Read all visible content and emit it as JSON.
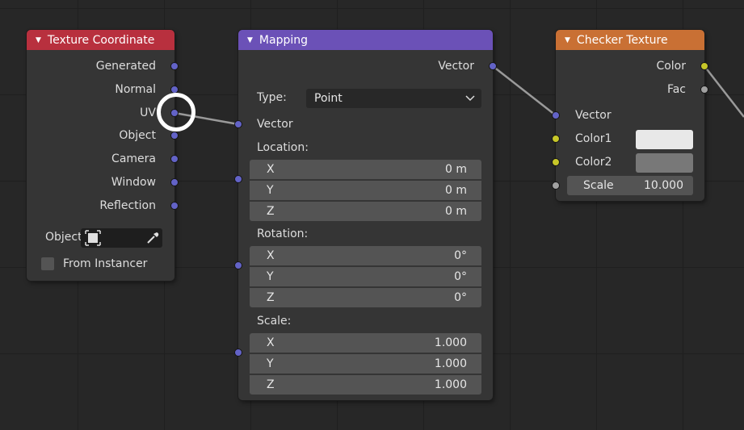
{
  "nodes": {
    "texture_coordinate": {
      "title": "Texture Coordinate",
      "header_color": "#b8303e",
      "outputs": [
        "Generated",
        "Normal",
        "UV",
        "Object",
        "Camera",
        "Window",
        "Reflection"
      ],
      "object_label": "Object",
      "from_instancer_label": "From Instancer"
    },
    "mapping": {
      "title": "Mapping",
      "header_color": "#6b51b7",
      "output_label": "Vector",
      "type_label": "Type:",
      "type_value": "Point",
      "vector_input_label": "Vector",
      "location": {
        "label": "Location:",
        "x": "0 m",
        "y": "0 m",
        "z": "0 m"
      },
      "rotation": {
        "label": "Rotation:",
        "x": "0°",
        "y": "0°",
        "z": "0°"
      },
      "scale": {
        "label": "Scale:",
        "x": "1.000",
        "y": "1.000",
        "z": "1.000"
      },
      "axis_x": "X",
      "axis_y": "Y",
      "axis_z": "Z"
    },
    "checker_texture": {
      "title": "Checker Texture",
      "header_color": "#c97034",
      "outputs": [
        "Color",
        "Fac"
      ],
      "vector_input_label": "Vector",
      "color1_label": "Color1",
      "color1_value": "#e8e8e8",
      "color2_label": "Color2",
      "color2_value": "#787878",
      "scale_label": "Scale",
      "scale_value": "10.000"
    }
  },
  "colors": {
    "socket_vector": "#6363c7",
    "socket_color": "#c7c729",
    "socket_float": "#a1a1a1",
    "link": "#a0a0a0"
  }
}
